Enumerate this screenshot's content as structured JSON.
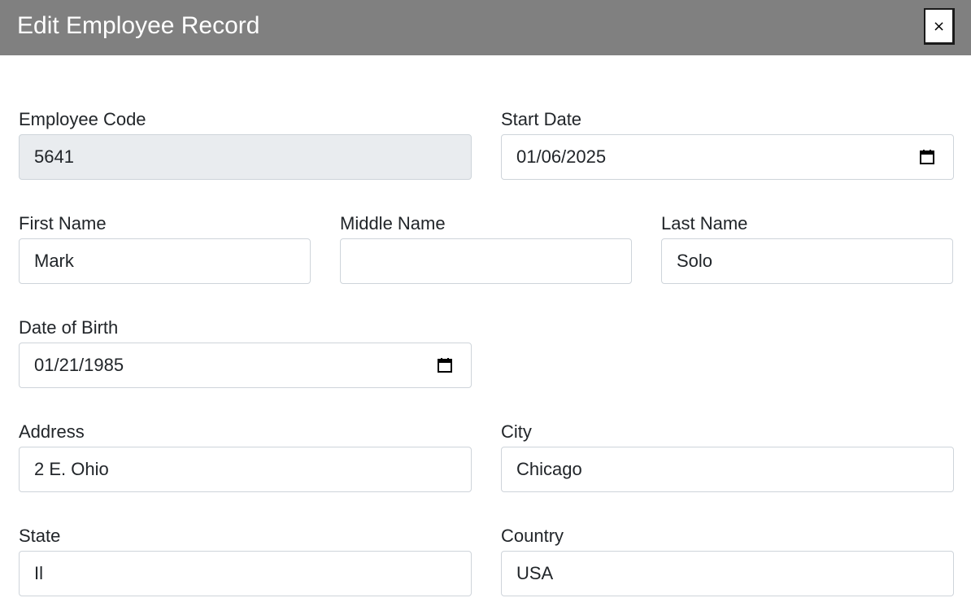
{
  "modal": {
    "title": "Edit Employee Record",
    "close_label": "×"
  },
  "form": {
    "employee_code": {
      "label": "Employee Code",
      "value": "5641"
    },
    "start_date": {
      "label": "Start Date",
      "value": "01/06/2025"
    },
    "first_name": {
      "label": "First Name",
      "value": "Mark"
    },
    "middle_name": {
      "label": "Middle Name",
      "value": ""
    },
    "last_name": {
      "label": "Last Name",
      "value": "Solo"
    },
    "date_of_birth": {
      "label": "Date of Birth",
      "value": "01/21/1985"
    },
    "address": {
      "label": "Address",
      "value": "2 E. Ohio"
    },
    "city": {
      "label": "City",
      "value": "Chicago"
    },
    "state": {
      "label": "State",
      "value": "Il"
    },
    "country": {
      "label": "Country",
      "value": "USA"
    }
  },
  "icons": {
    "date_picker": "calendar-icon"
  },
  "colors": {
    "header_bg": "#808080",
    "readonly_bg": "#e9ecef",
    "field_border": "#ced4da"
  }
}
